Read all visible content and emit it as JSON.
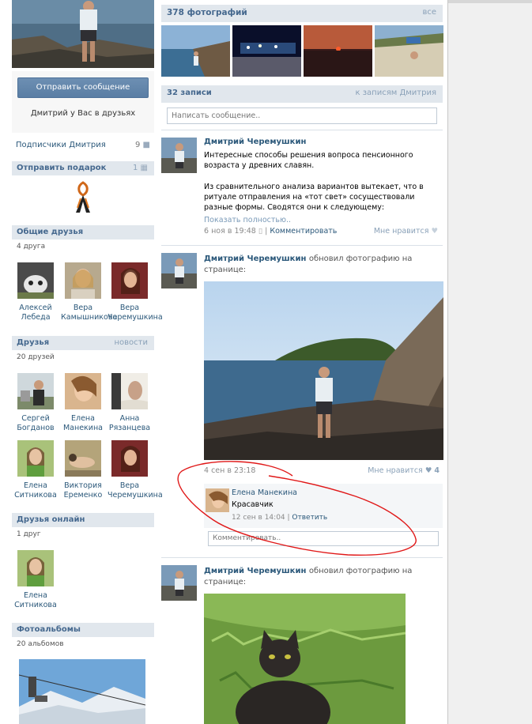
{
  "left": {
    "send_message": "Отправить сообщение",
    "friend_note": "Дмитрий  у Вас в друзьях",
    "subscribers": {
      "label": "Подписчики Дмитрия",
      "count": "9"
    },
    "gift": {
      "title": "Отправить подарок",
      "count": "1"
    },
    "mutual": {
      "title": "Общие друзья",
      "sub": "4 друга",
      "people": [
        {
          "first": "Алексей",
          "last": "Лебеда"
        },
        {
          "first": "Вера",
          "last": "Камышникова"
        },
        {
          "first": "Вера",
          "last": "Черемушкина"
        }
      ]
    },
    "friends": {
      "title": "Друзья",
      "link": "новости",
      "sub": "20 друзей",
      "people": [
        {
          "first": "Сергей",
          "last": "Богданов"
        },
        {
          "first": "Елена",
          "last": "Манекина"
        },
        {
          "first": "Анна",
          "last": "Рязанцева"
        },
        {
          "first": "Елена",
          "last": "Ситникова"
        },
        {
          "first": "Виктория",
          "last": "Еременко"
        },
        {
          "first": "Вера",
          "last": "Черемушкина"
        }
      ]
    },
    "online": {
      "title": "Друзья онлайн",
      "sub": "1 друг",
      "people": [
        {
          "first": "Елена",
          "last": "Ситникова"
        }
      ]
    },
    "albums": {
      "title": "Фотоальбомы",
      "sub": "20 альбомов"
    }
  },
  "main": {
    "photos": {
      "title": "378 фотографий",
      "all": "все"
    },
    "posts": {
      "title": "32 записи",
      "all": "к записям Дмитрия"
    },
    "composer_placeholder": "Написать сообщение..",
    "post1": {
      "author": "Дмитрий Черемушкин",
      "text1": "Интересные способы решения вопроса пенсионного возраста у древних славян.",
      "text2": "Из сравнительного анализа вариантов вытекает, что в ритуале отправления на «тот свет» сосуществовали разные формы. Сводятся они к следующему:",
      "more": "Показать полностью..",
      "date": "6 ноя в 19:48",
      "comment": "Комментировать",
      "like": "Мне нравится"
    },
    "post2": {
      "author": "Дмитрий Черемушкин",
      "action": "обновил фотографию на странице:",
      "date": "4 сен в 23:18",
      "like": "Мне нравится",
      "like_count": "4",
      "comment": {
        "author": "Елена Манекина",
        "text": "Красавчик",
        "date": "12 сен в 14:04",
        "reply": "Ответить"
      },
      "comment_placeholder": "Комментировать.."
    },
    "post3": {
      "author": "Дмитрий Черемушкин",
      "action": "обновил фотографию на странице:"
    }
  },
  "colors": {
    "accent": "#45688e",
    "link": "#2b587a",
    "head_bg": "#e1e7ed",
    "button": "#5a7ea4",
    "scribble": "#e01818"
  }
}
